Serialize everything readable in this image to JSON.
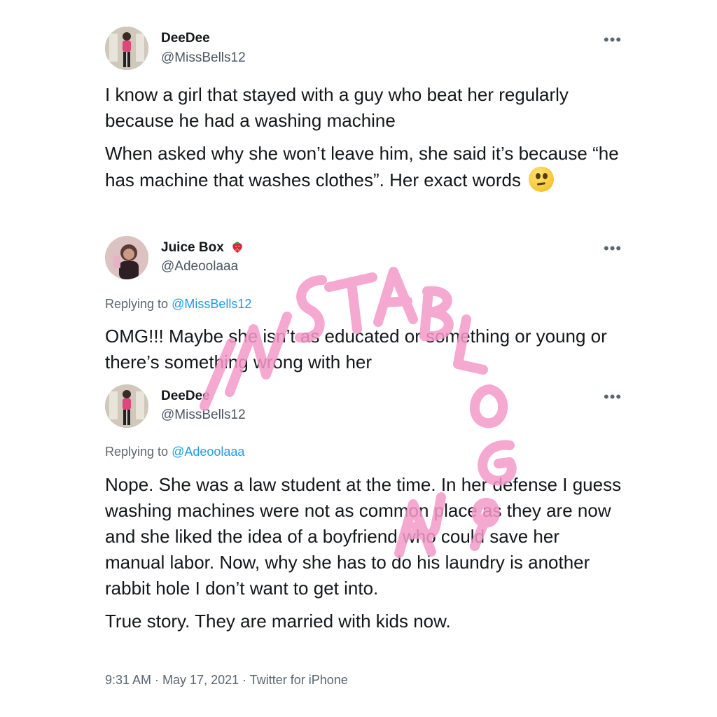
{
  "tweets": [
    {
      "name": "DeeDee",
      "handle": "@MissBells12",
      "paragraphs": [
        "I know a girl that stayed with a guy who beat her regularly because he had a washing machine",
        "When asked why she won’t leave him, she said it’s because “he has  machine that washes clothes”. Her exact words"
      ],
      "emoji": "face-with-rolling-eyes-icon"
    },
    {
      "name": "Juice Box",
      "name_emoji": "strawberry-icon",
      "handle": "@Adeoolaaa",
      "replying_prefix": "Replying to ",
      "replying_to": "@MissBells12",
      "paragraphs": [
        "OMG!!! Maybe she isn’t as educated or something or young or there’s something wrong with her"
      ]
    },
    {
      "name": "DeeDee",
      "handle": "@MissBells12",
      "replying_prefix": "Replying to ",
      "replying_to": "@Adeoolaaa",
      "paragraphs": [
        "Nope. She was a law student at the time. In her defense I guess washing machines were not as common place as they are now and she liked the idea of a boyfriend who could save her manual labor. Now, why she has to do his laundry is another rabbit hole I don’t want to get into.",
        "True story. They are married with kids now."
      ],
      "meta": "9:31 AM · May 17, 2021 · Twitter for iPhone"
    }
  ],
  "more_label": "•••",
  "watermark": "INSTABLOG9JA",
  "colors": {
    "mention": "#1d9bf0",
    "watermark": "#f49ac8",
    "secondary": "#5b6570"
  }
}
